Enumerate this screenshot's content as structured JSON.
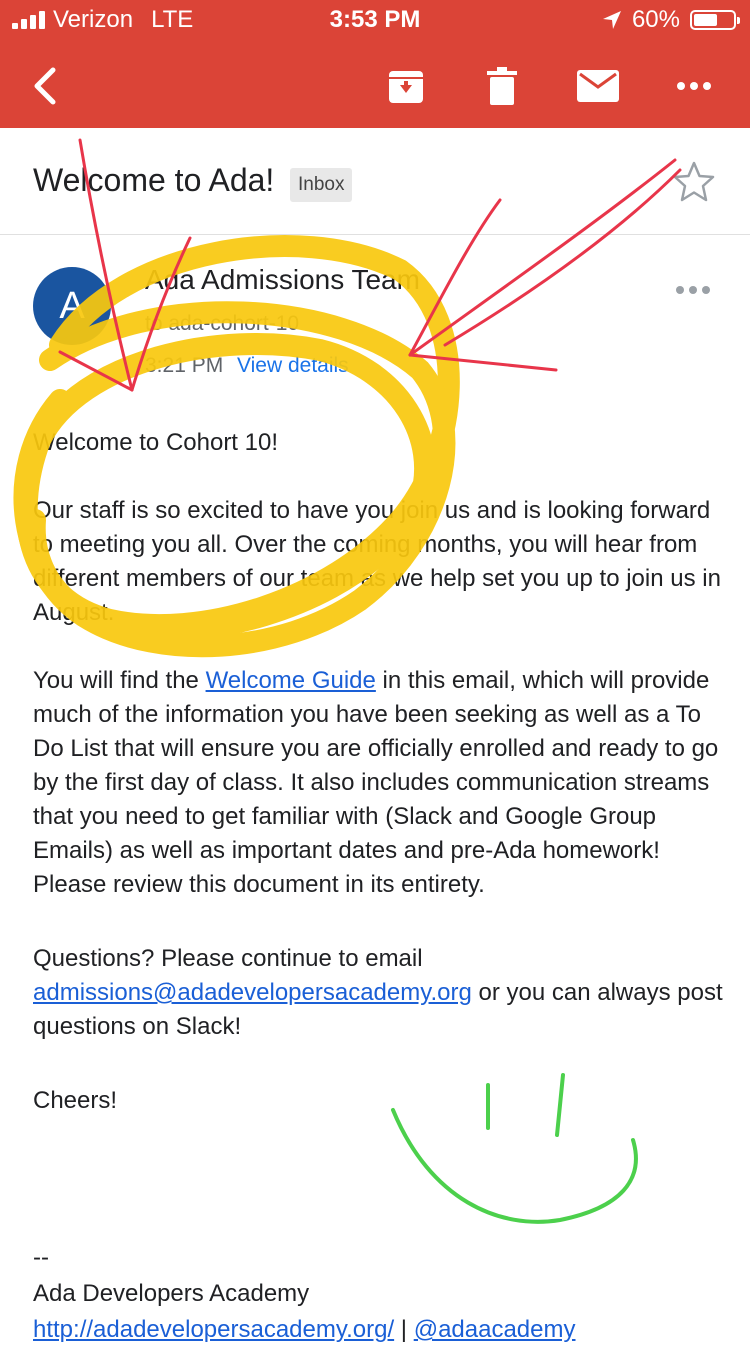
{
  "status_bar": {
    "carrier": "Verizon",
    "network": "LTE",
    "time": "3:53 PM",
    "battery": "60%",
    "battery_level": 0.6
  },
  "toolbar": {
    "back_icon": "back-arrow-icon",
    "archive_icon": "archive-icon",
    "delete_icon": "trash-icon",
    "mark_unread_icon": "mail-icon",
    "more_icon": "more-horizontal-icon"
  },
  "colors": {
    "app_bar": "#db4437",
    "avatar": "#1a55a0",
    "link": "#1a5fd6",
    "annotation_yellow": "#f9c80e",
    "annotation_red": "#e8354a",
    "annotation_green": "#4cd04c"
  },
  "email": {
    "subject": "Welcome to Ada!",
    "label": "Inbox",
    "avatar_letter": "A",
    "sender": "Ada Admissions Team",
    "recipient": "to ada-cohort-10",
    "time": "3:21 PM",
    "view_details": "View details",
    "greeting": "Welcome to Cohort 10!",
    "para1": "Our staff is so excited to have you join us and is looking forward to meeting you all. Over the coming months, you will hear from different members of our team as we help set you up to join us in August.",
    "para2_before": "You will find the ",
    "para2_link": "Welcome Guide",
    "para2_after": " in this email, which will provide much of the information you have been seeking as well as a To Do List that will ensure you are officially enrolled and ready to go by the first day of class. It also includes communication streams that you need to get familiar with (Slack and Google Group Emails) as well as important dates and pre-Ada homework! Please review this document in its entirety.",
    "para3_before": "Questions? Please continue to email ",
    "para3_link": "admissions@adadevelopersacademy.org",
    "para3_after": " or you can always post questions on Slack!",
    "signoff": "Cheers!",
    "sig_dash": "--",
    "sig_name": "Ada Developers Academy",
    "sig_url": "http://adadevelopersacademy.org/",
    "sig_sep": " | ",
    "sig_handle": "@adaacademy"
  }
}
